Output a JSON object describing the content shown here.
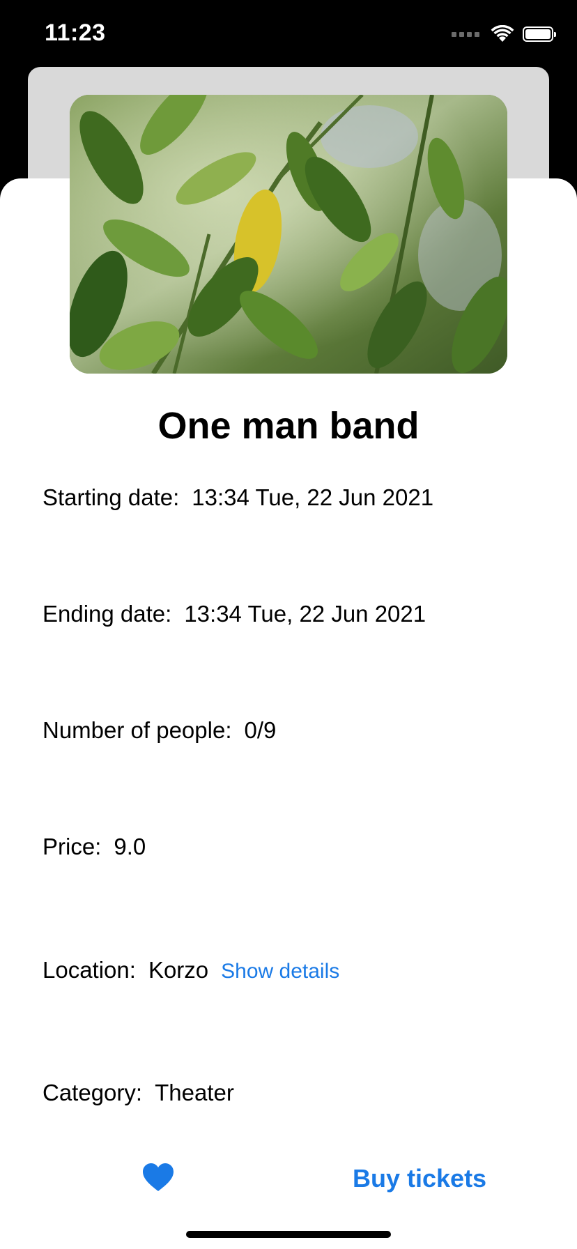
{
  "status_bar": {
    "time": "11:23"
  },
  "event": {
    "title": "One man band",
    "image_icon": "plant-photo"
  },
  "details": [
    {
      "label": "Starting date:",
      "value": "13:34 Tue, 22 Jun 2021"
    },
    {
      "label": "Ending date:",
      "value": "13:34 Tue, 22 Jun 2021"
    },
    {
      "label": "Number of people:",
      "value": "0/9"
    },
    {
      "label": "Price:",
      "value": "9.0"
    },
    {
      "label": "Location:",
      "value": "Korzo",
      "link": "Show details"
    },
    {
      "label": "Category:",
      "value": "Theater"
    }
  ],
  "actions": {
    "favorite_icon": "heart-icon",
    "buy_label": "Buy tickets"
  },
  "colors": {
    "accent": "#1a7ae6",
    "background": "#ffffff",
    "status_bar": "#000000",
    "back_sheet": "#d9d9d9"
  }
}
